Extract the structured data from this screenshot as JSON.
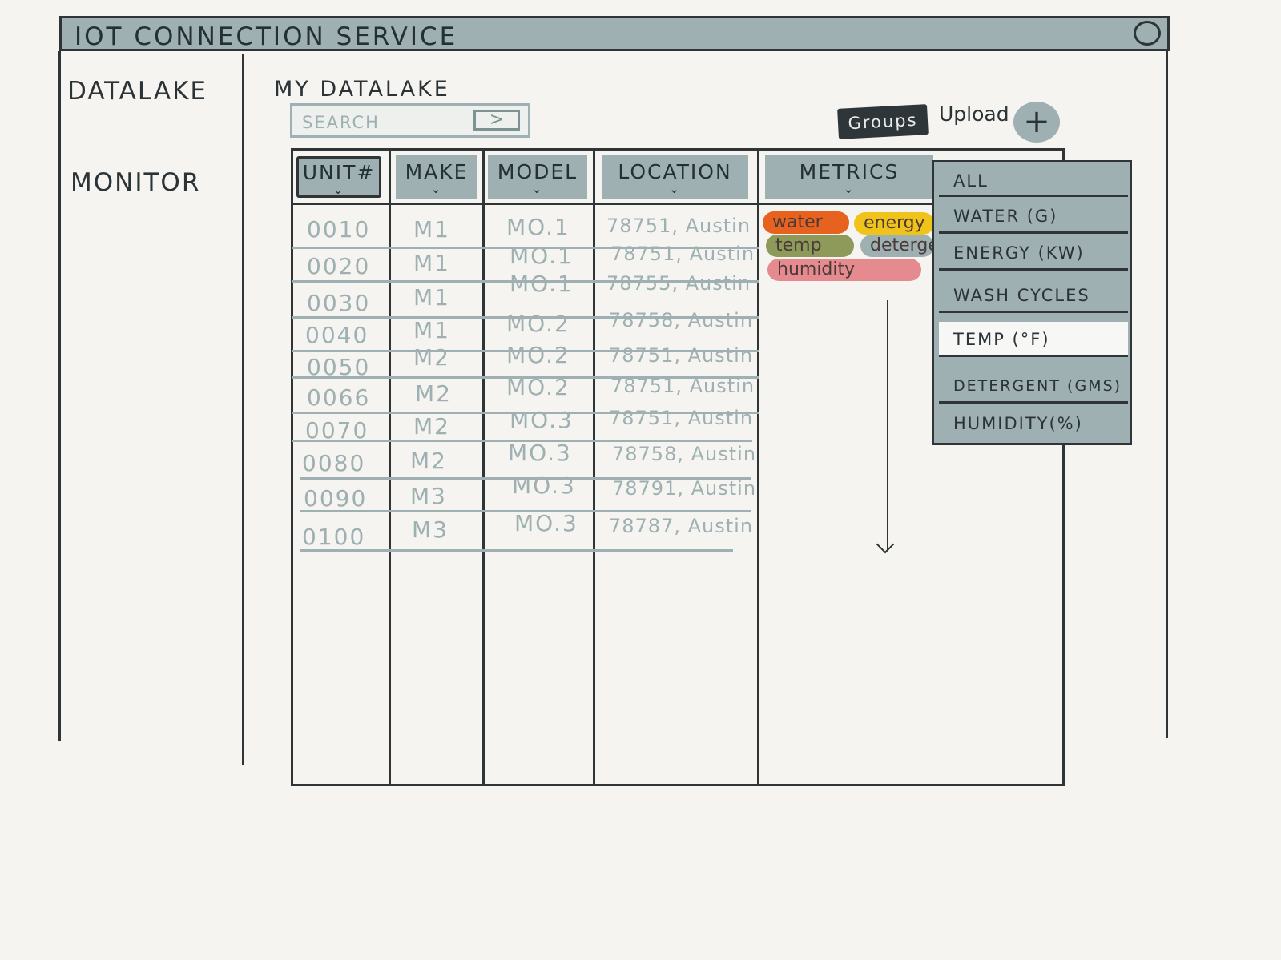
{
  "window": {
    "title": "IOT CONNECTION SERVICE"
  },
  "sidebar": {
    "items": [
      {
        "label": "DATALAKE"
      },
      {
        "label": "MONITOR"
      }
    ]
  },
  "main": {
    "section_title": "MY DATALAKE",
    "search": {
      "placeholder": "SEARCH",
      "submit_label": ">"
    },
    "toolbar": {
      "groups_label": "Groups",
      "upload_label": "Upload",
      "add_label": "+"
    },
    "table": {
      "columns": [
        {
          "label": "UNIT#"
        },
        {
          "label": "MAKE"
        },
        {
          "label": "MODEL"
        },
        {
          "label": "LOCATION"
        },
        {
          "label": "METRICS"
        }
      ],
      "rows": [
        {
          "unit": "0010",
          "make": "M1",
          "model": "MO.1",
          "location": "78751, Austin"
        },
        {
          "unit": "0020",
          "make": "M1",
          "model": "MO.1",
          "location": "78751, Austin"
        },
        {
          "unit": "0030",
          "make": "M1",
          "model": "MO.1",
          "location": "78755, Austin"
        },
        {
          "unit": "0040",
          "make": "M1",
          "model": "MO.2",
          "location": "78758, Austin"
        },
        {
          "unit": "0050",
          "make": "M2",
          "model": "MO.2",
          "location": "78751, Austin"
        },
        {
          "unit": "0066",
          "make": "M2",
          "model": "MO.2",
          "location": "78751, Austin"
        },
        {
          "unit": "0070",
          "make": "M2",
          "model": "MO.3",
          "location": "78751, Austin"
        },
        {
          "unit": "0080",
          "make": "M2",
          "model": "MO.3",
          "location": "78758, Austin"
        },
        {
          "unit": "0090",
          "make": "M3",
          "model": "MO.3",
          "location": "78791, Austin"
        },
        {
          "unit": "0100",
          "make": "M3",
          "model": "MO.3",
          "location": "78787, Austin"
        }
      ],
      "metric_chips": [
        {
          "label": "water",
          "color": "#e8621f"
        },
        {
          "label": "energy",
          "color": "#f0c31b"
        },
        {
          "label": "temp",
          "color": "#8e9a5a"
        },
        {
          "label": "detergent",
          "color": "#9eb0b2"
        },
        {
          "label": "humidity",
          "color": "#e58b8f"
        }
      ]
    },
    "metrics_dropdown": {
      "items": [
        {
          "label": "ALL"
        },
        {
          "label": "WATER (G)"
        },
        {
          "label": "ENERGY (KW)"
        },
        {
          "label": "WASH CYCLES"
        },
        {
          "label": "TEMP (°F)",
          "selected": true
        },
        {
          "label": "DETERGENT (GMS)"
        },
        {
          "label": "HUMIDITY(%)"
        }
      ]
    }
  },
  "colors": {
    "background": "#f5f4f0",
    "accent": "#9eb0b2",
    "ink": "#2f3537"
  }
}
